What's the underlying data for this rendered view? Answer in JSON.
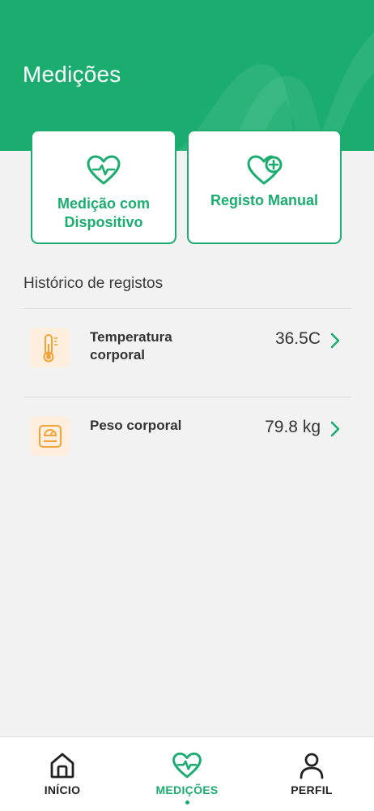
{
  "header": {
    "title": "Medições"
  },
  "actions": {
    "device_label": "Medição com Dispositivo",
    "manual_label": "Registo Manual"
  },
  "history": {
    "title": "Histórico de registos",
    "items": [
      {
        "name": "Temperatura corporal",
        "value": "36.5C",
        "icon": "thermometer-icon"
      },
      {
        "name": "Peso corporal",
        "value": "79.8 kg",
        "icon": "scale-icon"
      }
    ]
  },
  "nav": {
    "items": [
      {
        "label": "INÍCIO",
        "icon": "home-icon"
      },
      {
        "label": "MEDIÇÕES",
        "icon": "heart-pulse-icon",
        "active": true
      },
      {
        "label": "PERFIL",
        "icon": "user-icon"
      }
    ]
  },
  "colors": {
    "accent": "#1aad6f",
    "icon_orange": "#f0a33a",
    "thumb_bg": "#fdeedd"
  }
}
